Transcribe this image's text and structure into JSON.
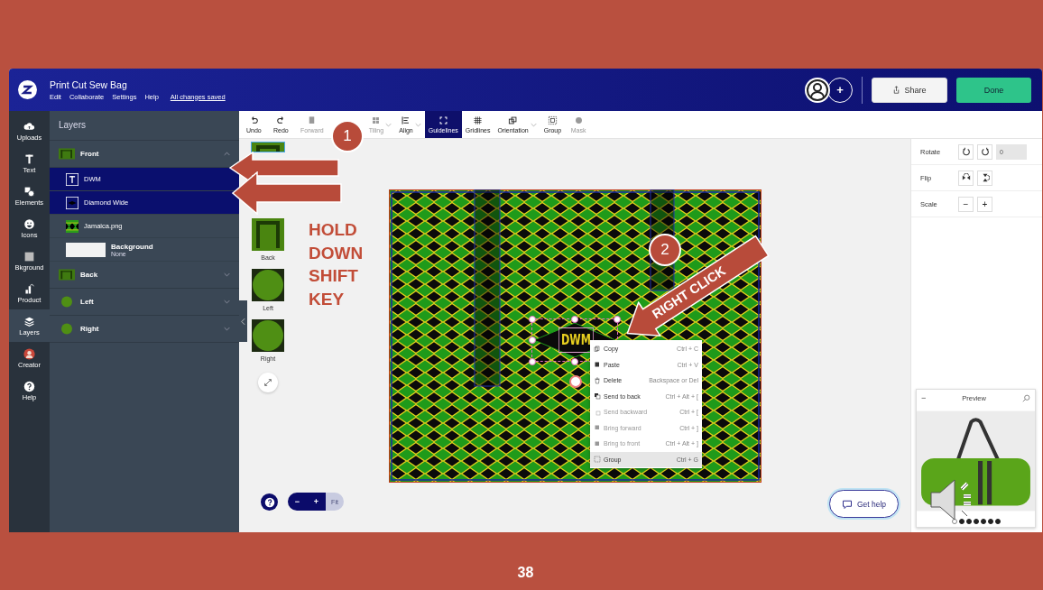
{
  "slide": {
    "page_number": "38"
  },
  "app": {
    "title": "Print Cut Sew Bag",
    "menu": [
      "Edit",
      "Collaborate",
      "Settings",
      "Help"
    ],
    "save_status": "All changes saved",
    "add_collaborator": "+",
    "share": "Share",
    "done": "Done"
  },
  "rail": [
    {
      "label": "Uploads",
      "selected": false
    },
    {
      "label": "Text",
      "selected": false
    },
    {
      "label": "Elements",
      "selected": false
    },
    {
      "label": "Icons",
      "selected": false
    },
    {
      "label": "Bkground",
      "selected": false
    },
    {
      "label": "Product",
      "selected": false
    },
    {
      "label": "Layers",
      "selected": true
    },
    {
      "label": "Creator",
      "selected": false
    },
    {
      "label": "Help",
      "selected": false
    }
  ],
  "layers": {
    "title": "Layers",
    "groups": [
      {
        "name": "Front",
        "kind": "rectangle",
        "expanded": true,
        "children": [
          {
            "kind": "text",
            "name": "DWM",
            "selected": true
          },
          {
            "kind": "shape",
            "name": "Diamond Wide",
            "selected": true
          },
          {
            "kind": "image",
            "name": "Jamaica.png",
            "selected": false
          },
          {
            "kind": "background",
            "name": "Background",
            "detail": "None",
            "selected": false
          }
        ]
      },
      {
        "name": "Back",
        "kind": "rectangle",
        "expanded": false
      },
      {
        "name": "Left",
        "kind": "round",
        "expanded": false
      },
      {
        "name": "Right",
        "kind": "round",
        "expanded": false
      }
    ]
  },
  "toolbar": [
    {
      "label": "Undo",
      "disabled": false,
      "dropdown": false,
      "selected": false
    },
    {
      "label": "Redo",
      "disabled": false,
      "dropdown": false,
      "selected": false
    },
    {
      "label": "Forward",
      "disabled": true,
      "dropdown": false,
      "selected": false
    },
    {
      "label": "Tiling",
      "disabled": true,
      "dropdown": true,
      "selected": false
    },
    {
      "label": "Align",
      "disabled": false,
      "dropdown": true,
      "selected": false
    },
    {
      "label": "Guidelines",
      "disabled": false,
      "dropdown": false,
      "selected": true
    },
    {
      "label": "Gridlines",
      "disabled": false,
      "dropdown": false,
      "selected": false
    },
    {
      "label": "Orientation",
      "disabled": false,
      "dropdown": true,
      "selected": false
    },
    {
      "label": "Group",
      "disabled": false,
      "dropdown": false,
      "selected": false
    },
    {
      "label": "Mask",
      "disabled": true,
      "dropdown": false,
      "selected": false
    }
  ],
  "sides": [
    {
      "kind": "rectangle",
      "selected": true
    },
    {
      "kind": "rectangle",
      "label": "Back",
      "selected": false
    },
    {
      "kind": "round",
      "label": "Left",
      "selected": false
    },
    {
      "kind": "round",
      "label": "Right",
      "selected": false
    }
  ],
  "canvas": {
    "text_element": "DWM",
    "context_menu": [
      {
        "label": "Copy",
        "shortcut": "Ctrl + C",
        "disabled": false,
        "highlighted": false
      },
      {
        "label": "Paste",
        "shortcut": "Ctrl + V",
        "disabled": false,
        "highlighted": false
      },
      {
        "label": "Delete",
        "shortcut": "Backspace or Del",
        "disabled": false,
        "highlighted": false
      },
      {
        "label": "Send to back",
        "shortcut": "Ctrl + Alt + [",
        "disabled": false,
        "highlighted": false
      },
      {
        "label": "Send backward",
        "shortcut": "Ctrl + [",
        "disabled": true,
        "highlighted": false
      },
      {
        "label": "Bring forward",
        "shortcut": "Ctrl + ]",
        "disabled": true,
        "highlighted": false
      },
      {
        "label": "Bring to front",
        "shortcut": "Ctrl + Alt + ]",
        "disabled": true,
        "highlighted": false
      },
      {
        "label": "Group",
        "shortcut": "Ctrl + G",
        "disabled": false,
        "highlighted": true
      }
    ]
  },
  "properties": [
    {
      "kind": "rotate",
      "label": "Rotate",
      "value": "0"
    },
    {
      "kind": "flip",
      "label": "Flip"
    },
    {
      "kind": "scale",
      "label": "Scale",
      "buttons": [
        "−",
        "+"
      ]
    }
  ],
  "zoom": {
    "buttons": [
      "−",
      "+"
    ],
    "fit": "Fit",
    "fit_disabled": true
  },
  "get_help": "Get help",
  "preview": {
    "title": "Preview",
    "minimize": "−",
    "dots": [
      {
        "selected": true
      },
      {
        "selected": false
      },
      {
        "selected": false
      },
      {
        "selected": false
      },
      {
        "selected": false
      },
      {
        "selected": false
      },
      {
        "selected": false
      }
    ]
  },
  "annotations": {
    "step_1": "1",
    "instruction": "HOLD DOWN SHIFT KEY",
    "step_2": "2",
    "callout": "RIGHT CLICK"
  }
}
